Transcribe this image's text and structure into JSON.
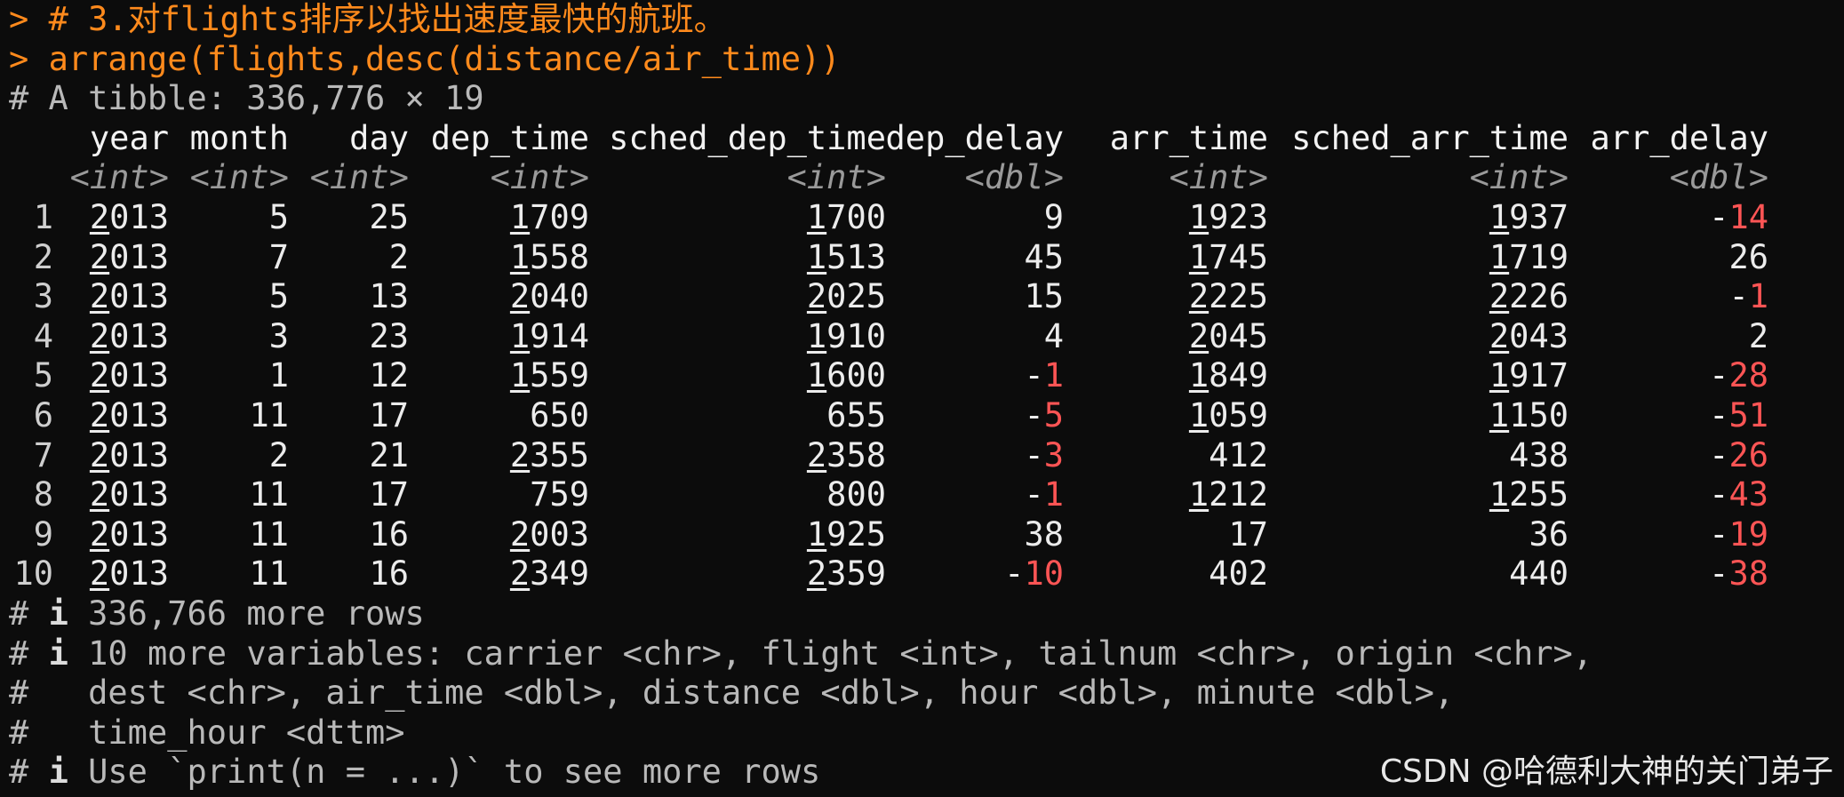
{
  "console": {
    "prompt_symbol": ">",
    "cmd1": "# 3.对flights排序以找出速度最快的航班。",
    "cmd2": "arrange(flights,desc(distance/air_time))",
    "tibble_info": "# A tibble: 336,776 × 19"
  },
  "table": {
    "columns": [
      "year",
      "month",
      "day",
      "dep_time",
      "sched_dep_time",
      "dep_delay",
      "arr_time",
      "sched_arr_time",
      "arr_delay"
    ],
    "types": [
      "<int>",
      "<int>",
      "<int>",
      "<int>",
      "<int>",
      "<dbl>",
      "<int>",
      "<int>",
      "<dbl>"
    ],
    "rows": [
      [
        "1",
        "2013",
        "5",
        "25",
        "1709",
        "1700",
        "9",
        "1923",
        "1937",
        "-14"
      ],
      [
        "2",
        "2013",
        "7",
        "2",
        "1558",
        "1513",
        "45",
        "1745",
        "1719",
        "26"
      ],
      [
        "3",
        "2013",
        "5",
        "13",
        "2040",
        "2025",
        "15",
        "2225",
        "2226",
        "-1"
      ],
      [
        "4",
        "2013",
        "3",
        "23",
        "1914",
        "1910",
        "4",
        "2045",
        "2043",
        "2"
      ],
      [
        "5",
        "2013",
        "1",
        "12",
        "1559",
        "1600",
        "-1",
        "1849",
        "1917",
        "-28"
      ],
      [
        "6",
        "2013",
        "11",
        "17",
        "650",
        "655",
        "-5",
        "1059",
        "1150",
        "-51"
      ],
      [
        "7",
        "2013",
        "2",
        "21",
        "2355",
        "2358",
        "-3",
        "412",
        "438",
        "-26"
      ],
      [
        "8",
        "2013",
        "11",
        "17",
        "759",
        "800",
        "-1",
        "1212",
        "1255",
        "-43"
      ],
      [
        "9",
        "2013",
        "11",
        "16",
        "2003",
        "1925",
        "38",
        "17",
        "36",
        "-19"
      ],
      [
        "10",
        "2013",
        "11",
        "16",
        "2349",
        "2359",
        "-10",
        "402",
        "440",
        "-38"
      ]
    ]
  },
  "footer": {
    "more_rows": "336,766 more rows",
    "more_vars_1": "10 more variables: carrier <chr>, flight <int>, tailnum <chr>, origin <chr>,",
    "more_vars_2": "  dest <chr>, air_time <dbl>, distance <dbl>, hour <dbl>, minute <dbl>,",
    "more_vars_3": "  time_hour <dttm>",
    "use_print": "Use `print(n = ...)` to see more rows",
    "info_icon": "i"
  },
  "watermark": "CSDN @哈德利大神的关门弟子",
  "colors": {
    "background": "#0c0c0c",
    "prompt": "#ff8a1c",
    "negative": "#ff5555",
    "comment": "#b9b9b9"
  }
}
